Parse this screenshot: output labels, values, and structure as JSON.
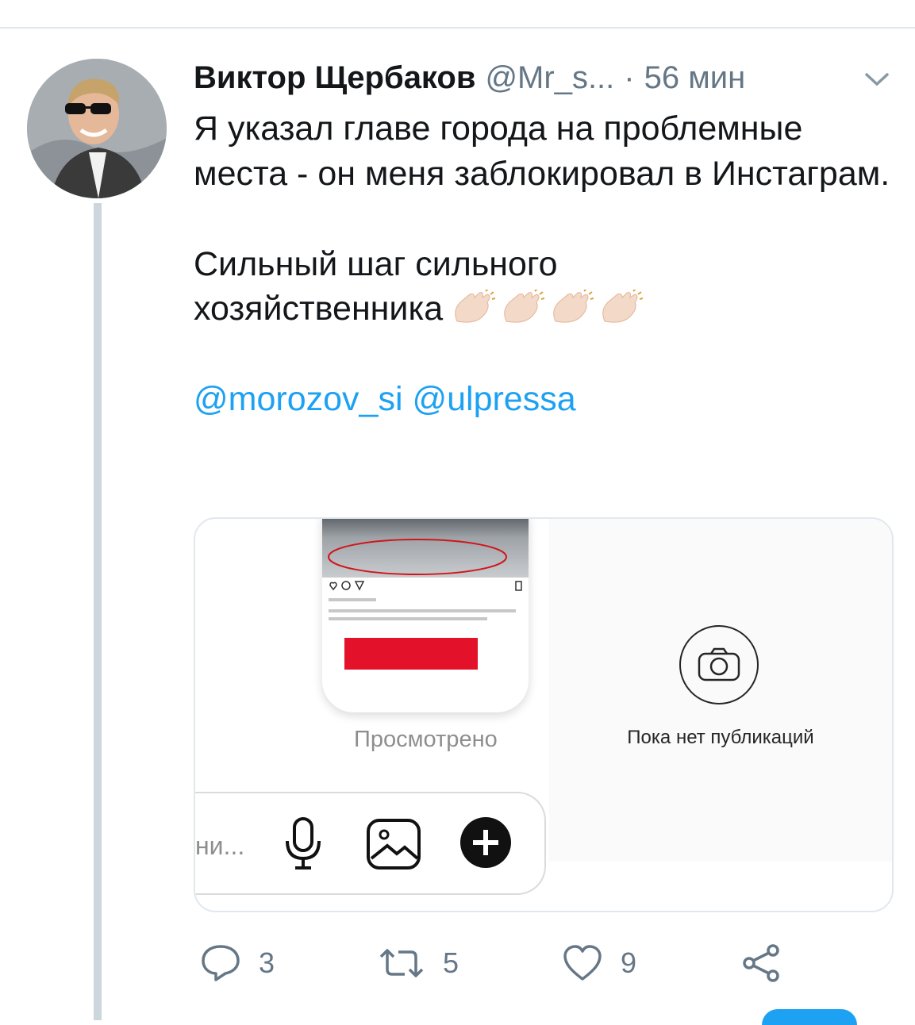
{
  "tweet": {
    "author_name": "Виктор Щербаков",
    "handle": "@Mr_s...",
    "separator": "·",
    "time": "56 мин",
    "lines": {
      "p1": "Я указал главе города на проблемные места - он меня заблокировал в Инстаграм.",
      "p2a": "Сильный шаг сильного",
      "p2b": "хозяйственника",
      "mentions": "@morozov_si @ulpressa"
    },
    "emoji_icons": [
      "clapping-hands-icon",
      "clapping-hands-icon",
      "clapping-hands-icon",
      "clapping-hands-icon"
    ]
  },
  "media": {
    "story_seen_label": "Просмотрено",
    "composer_placeholder": "ни...",
    "no_posts_label": "Пока нет публикаций"
  },
  "actions": {
    "replies": "3",
    "retweets": "5",
    "likes": "9"
  },
  "colors": {
    "link": "#1da1f2",
    "muted": "#657786",
    "thread": "#ccd6dd"
  }
}
